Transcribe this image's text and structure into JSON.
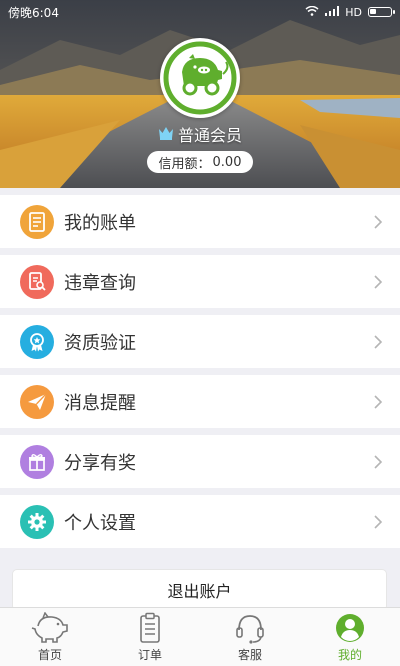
{
  "status_bar": {
    "time": "傍晚6:04",
    "network": "HD"
  },
  "profile": {
    "member_level": "普通会员",
    "credit_label": "信用额：",
    "credit_value": "0.00"
  },
  "menu": [
    {
      "label": "我的账单",
      "icon": "bill-icon",
      "color": "#f0a43a"
    },
    {
      "label": "违章查询",
      "icon": "violation-search-icon",
      "color": "#f06a5c"
    },
    {
      "label": "资质验证",
      "icon": "certificate-icon",
      "color": "#26aee0"
    },
    {
      "label": "消息提醒",
      "icon": "paper-plane-icon",
      "color": "#f59a3f"
    },
    {
      "label": "分享有奖",
      "icon": "gift-icon",
      "color": "#b07fe0"
    },
    {
      "label": "个人设置",
      "icon": "gear-icon",
      "color": "#2ac0b4"
    }
  ],
  "logout_label": "退出账户",
  "tabs": [
    {
      "label": "首页",
      "icon": "pig-icon"
    },
    {
      "label": "订单",
      "icon": "clipboard-icon"
    },
    {
      "label": "客服",
      "icon": "headset-icon"
    },
    {
      "label": "我的",
      "icon": "user-icon",
      "active": true
    }
  ],
  "colors": {
    "accent": "#5fae2d",
    "background": "#efeff4"
  }
}
